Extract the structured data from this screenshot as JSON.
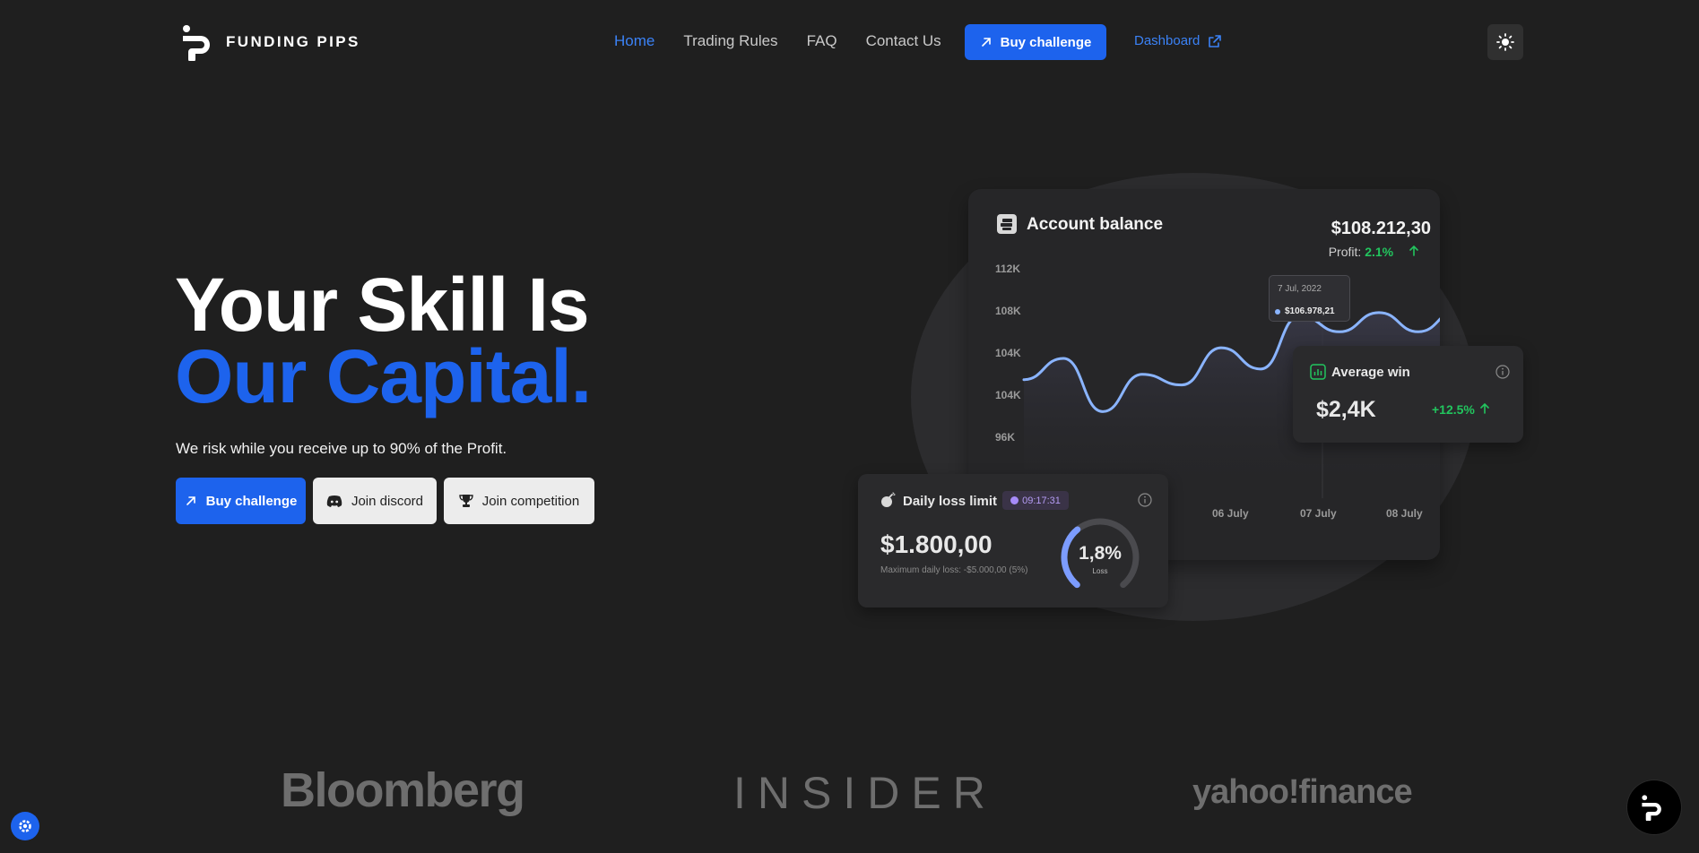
{
  "brand": {
    "name": "FUNDING PIPS"
  },
  "nav": {
    "items": [
      {
        "label": "Home",
        "active": true
      },
      {
        "label": "Trading Rules",
        "active": false
      },
      {
        "label": "FAQ",
        "active": false
      },
      {
        "label": "Contact Us",
        "active": false
      }
    ],
    "buy_label": "Buy challenge",
    "dashboard_label": "Dashboard"
  },
  "hero": {
    "title_line1": "Your Skill Is",
    "title_line2": "Our Capital.",
    "subtitle": "We risk while you receive up to 90% of the Profit.",
    "cta_buy": "Buy challenge",
    "cta_discord": "Join discord",
    "cta_competition": "Join competition"
  },
  "account_card": {
    "title": "Account balance",
    "balance": "$108.212,30",
    "profit_label": "Profit:",
    "profit_value": "2.1%",
    "tooltip_date": "7 Jul, 2022",
    "tooltip_value": "$106.978,21"
  },
  "chart_data": {
    "type": "line",
    "y_tick_labels": [
      "112K",
      "108K",
      "104K",
      "104K",
      "96K"
    ],
    "x_tick_labels": [
      "06 July",
      "07 July",
      "08 July"
    ],
    "series": [
      {
        "values": [
          101.5,
          103.5,
          98.5,
          102,
          101,
          104.5,
          102.5,
          107.5,
          106,
          107.8,
          106,
          108
        ]
      }
    ],
    "ylim": [
      96,
      112
    ]
  },
  "win_card": {
    "title": "Average win",
    "value": "$2,4K",
    "change": "+12.5%"
  },
  "loss_card": {
    "title": "Daily loss limit",
    "timer": "09:17:31",
    "value": "$1.800,00",
    "subtitle": "Maximum daily loss: -$5.000,00 (5%)",
    "gauge_value": "1,8%",
    "gauge_label": "Loss",
    "gauge_fraction": 0.36
  },
  "press": [
    "Bloomberg",
    "INSIDER",
    "yahoo!finance"
  ],
  "colors": {
    "accent": "#1d63ed",
    "positive": "#22c55e",
    "line": "#8ab4ff",
    "background": "#1f1f1f"
  },
  "icons": {
    "theme": "sun-icon",
    "external": "external-link-icon",
    "arrow": "arrow-up-right-icon",
    "discord": "discord-icon",
    "trophy": "trophy-icon",
    "chat": "chat-logo-icon",
    "settings": "gear-icon"
  }
}
